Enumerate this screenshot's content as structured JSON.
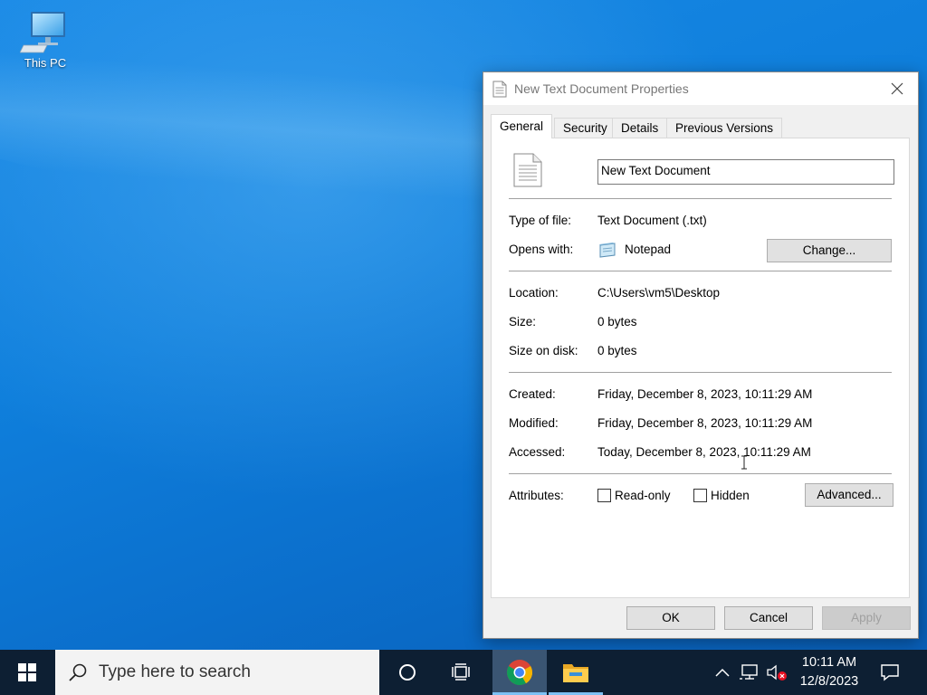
{
  "desktop": {
    "icons": [
      {
        "label": "This PC",
        "icon": "this-pc-icon"
      }
    ]
  },
  "dialog": {
    "title": "New Text Document Properties",
    "tabs": [
      "General",
      "Security",
      "Details",
      "Previous Versions"
    ],
    "active_tab": "General",
    "file_name": "New Text Document",
    "type_of_file_label": "Type of file:",
    "type_of_file_value": "Text Document (.txt)",
    "opens_with_label": "Opens with:",
    "opens_with_value": "Notepad",
    "change_button": "Change...",
    "location_label": "Location:",
    "location_value": "C:\\Users\\vm5\\Desktop",
    "size_label": "Size:",
    "size_value": "0 bytes",
    "size_on_disk_label": "Size on disk:",
    "size_on_disk_value": "0 bytes",
    "created_label": "Created:",
    "created_value": "Friday, December 8, 2023, 10:11:29 AM",
    "modified_label": "Modified:",
    "modified_value": "Friday, December 8, 2023, 10:11:29 AM",
    "accessed_label": "Accessed:",
    "accessed_value": "Today, December 8, 2023, 10:11:29 AM",
    "attributes_label": "Attributes:",
    "readonly_label": "Read-only",
    "readonly_checked": false,
    "hidden_label": "Hidden",
    "hidden_checked": false,
    "advanced_button": "Advanced...",
    "ok_button": "OK",
    "cancel_button": "Cancel",
    "apply_button": "Apply"
  },
  "taskbar": {
    "search_placeholder": "Type here to search",
    "apps": [
      "chrome-icon",
      "file-explorer-icon"
    ],
    "active_app": "chrome-icon",
    "time": "10:11 AM",
    "date": "12/8/2023"
  },
  "colors": {
    "desktop_blue": "#0f7fdc",
    "taskbar": "#0d1f33",
    "active_tab_accent": "#7cc0f4"
  }
}
